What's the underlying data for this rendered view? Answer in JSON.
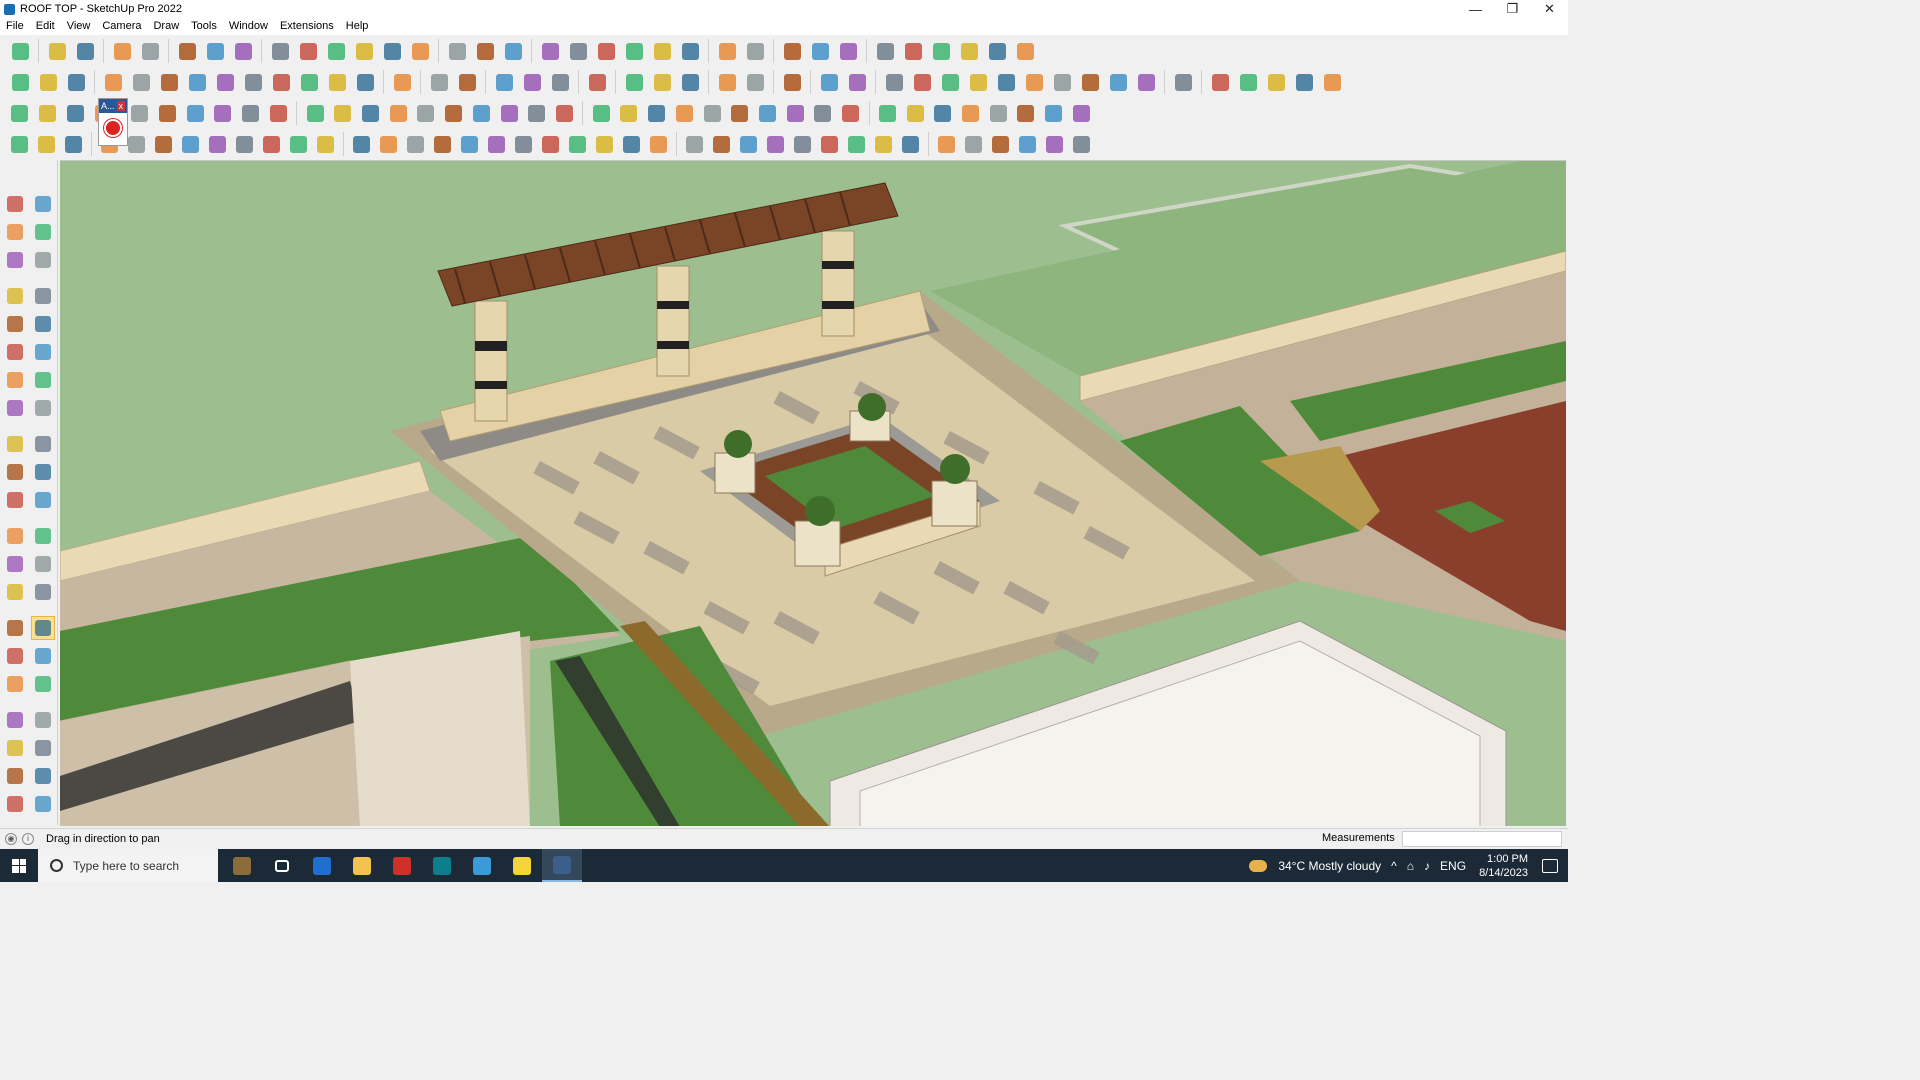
{
  "window": {
    "title": "ROOF TOP - SketchUp Pro 2022",
    "minimize": "—",
    "maximize": "❐",
    "close": "✕"
  },
  "menu": [
    "File",
    "Edit",
    "View",
    "Camera",
    "Draw",
    "Tools",
    "Window",
    "Extensions",
    "Help"
  ],
  "tag_popup": {
    "label": "A...",
    "close": "x"
  },
  "status": {
    "text": "Drag in direction to pan",
    "measurements_label": "Measurements",
    "measurements_value": ""
  },
  "taskbar": {
    "search_placeholder": "Type here to search",
    "weather": "34°C  Mostly cloudy",
    "language": "ENG",
    "time": "1:00 PM",
    "date": "8/14/2023",
    "apps": [
      "file-explorer",
      "task-view",
      "calculator",
      "folder",
      "acrobat",
      "3dsmax",
      "edge",
      "sticky-notes",
      "sketchup"
    ]
  },
  "colors": {
    "sky_lawn": "#9dbf8f",
    "grass": "#4f8a3a",
    "paving": "#d8cba6",
    "wood": "#7a4427",
    "stone_wall": "#e9d9b4",
    "deck": "#8a3f2c",
    "active_tool": "#fde08c"
  }
}
